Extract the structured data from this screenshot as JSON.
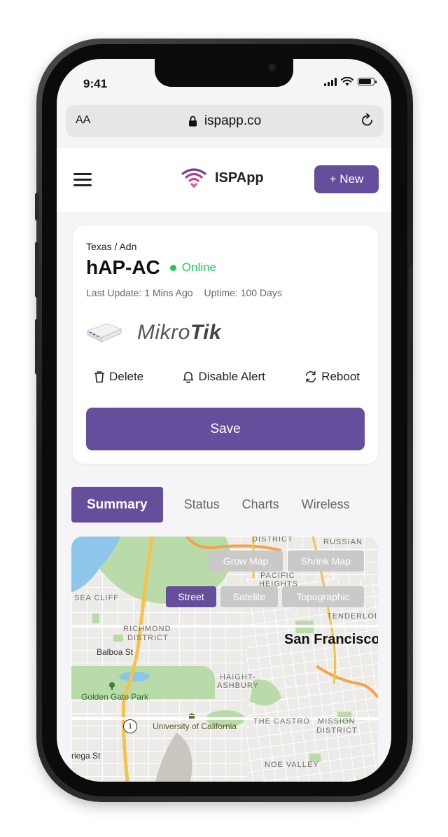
{
  "status_bar": {
    "time": "9:41"
  },
  "browser": {
    "text_size_label": "AA",
    "url": "ispapp.co"
  },
  "header": {
    "brand_name": "ISPApp",
    "new_button": "+ New"
  },
  "device": {
    "breadcrumb": "Texas / Adn",
    "name": "hAP-AC",
    "status": "Online",
    "last_update": "Last Update: 1 Mins Ago",
    "uptime": "Uptime: 100 Days",
    "vendor_a": "Mikro",
    "vendor_b": "Tik",
    "actions": {
      "delete": "Delete",
      "disable_alert": "Disable Alert",
      "reboot": "Reboot"
    },
    "save": "Save"
  },
  "tabs": [
    {
      "label": "Summary",
      "active": true
    },
    {
      "label": "Status"
    },
    {
      "label": "Charts"
    },
    {
      "label": "Wireless"
    }
  ],
  "map": {
    "grow": "Grow Map",
    "shrink": "Shrink Map",
    "styles": [
      "Street",
      "Satelite",
      "Topographic"
    ],
    "labels": {
      "district": "DISTRICT",
      "russian": "RUSSIAN",
      "pacific1": "PACIFIC",
      "pacific2": "HEIGHTS",
      "sea_cliff": "SEA CLIFF",
      "tenderloin": "TENDERLOIN",
      "richmond1": "RICHMOND",
      "richmond2": "DISTRICT",
      "san_francisco": "San Francisco",
      "balboa": "Balboa St",
      "haight1": "HAIGHT-",
      "haight2": "ASHBURY",
      "golden_gate": "Golden Gate Park",
      "route": "1",
      "ucsf": "University of California",
      "castro": "THE CASTRO",
      "mission1": "MISSION",
      "mission2": "DISTRICT",
      "ortega": "riega St",
      "noe": "NOE VALLEY"
    }
  },
  "colors": {
    "accent": "#654e9b",
    "online": "#22c55e"
  }
}
